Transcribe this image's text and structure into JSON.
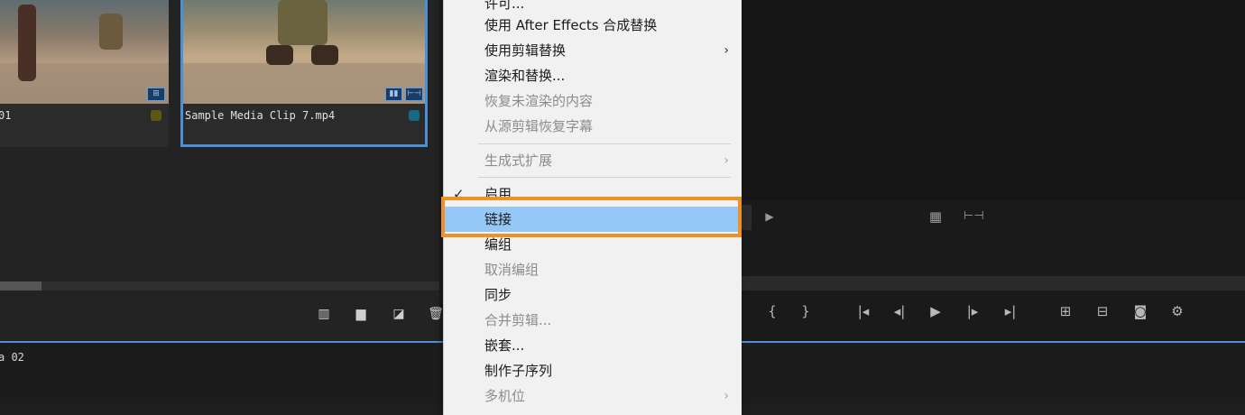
{
  "project": {
    "clips": [
      {
        "name": "01",
        "label_color": "#5a5a14",
        "badge_icons": [
          "storyboard-icon"
        ]
      },
      {
        "name": "Sample Media Clip 7.mp4",
        "label_color": "#156b86",
        "selected": true,
        "badge_icons": [
          "video-badge-icon",
          "audio-badge-icon"
        ]
      }
    ],
    "toolbar_icons": [
      "freeform-view-icon",
      "new-bin-icon",
      "new-item-icon",
      "trash-icon"
    ]
  },
  "timeline": {
    "sequence_label": "a 02"
  },
  "context_menu": {
    "items": [
      {
        "label": "许可...",
        "disabled": false
      },
      {
        "label": "使用 After Effects 合成替换",
        "disabled": false
      },
      {
        "label": "使用剪辑替换",
        "disabled": false,
        "submenu": true
      },
      {
        "label": "渲染和替换...",
        "disabled": false
      },
      {
        "label": "恢复未渲染的内容",
        "disabled": true
      },
      {
        "label": "从源剪辑恢复字幕",
        "disabled": true
      },
      {
        "label": "生成式扩展",
        "disabled": true,
        "submenu": true
      },
      {
        "label": "启用",
        "disabled": false,
        "checked": true
      },
      {
        "label": "链接",
        "disabled": false,
        "highlighted": true
      },
      {
        "label": "编组",
        "disabled": false
      },
      {
        "label": "取消编组",
        "disabled": true
      },
      {
        "label": "同步",
        "disabled": false
      },
      {
        "label": "合并剪辑...",
        "disabled": true
      },
      {
        "label": "嵌套...",
        "disabled": false
      },
      {
        "label": "制作子序列",
        "disabled": false
      },
      {
        "label": "多机位",
        "disabled": true,
        "submenu": true
      }
    ],
    "submenu_arrow": "›",
    "check_mark": "✓"
  },
  "monitor": {
    "transport_icons": [
      "mark-in-icon",
      "mark-out-icon",
      "go-to-in-icon",
      "step-back-icon",
      "play-icon",
      "step-forward-icon",
      "go-to-out-icon",
      "insert-icon",
      "overwrite-icon",
      "export-frame-icon",
      "settings-icon"
    ],
    "glyphs": {
      "mark_in": "{",
      "mark_out": "}",
      "go_in": "|◂",
      "step_back": "◂|",
      "play": "▶",
      "step_fwd": "|▸",
      "go_out": "▸|",
      "play_small": "▶"
    }
  },
  "colors": {
    "highlight": "#96c8f7",
    "focus_outline": "#ef9226",
    "selection_blue": "#4a90d9"
  }
}
